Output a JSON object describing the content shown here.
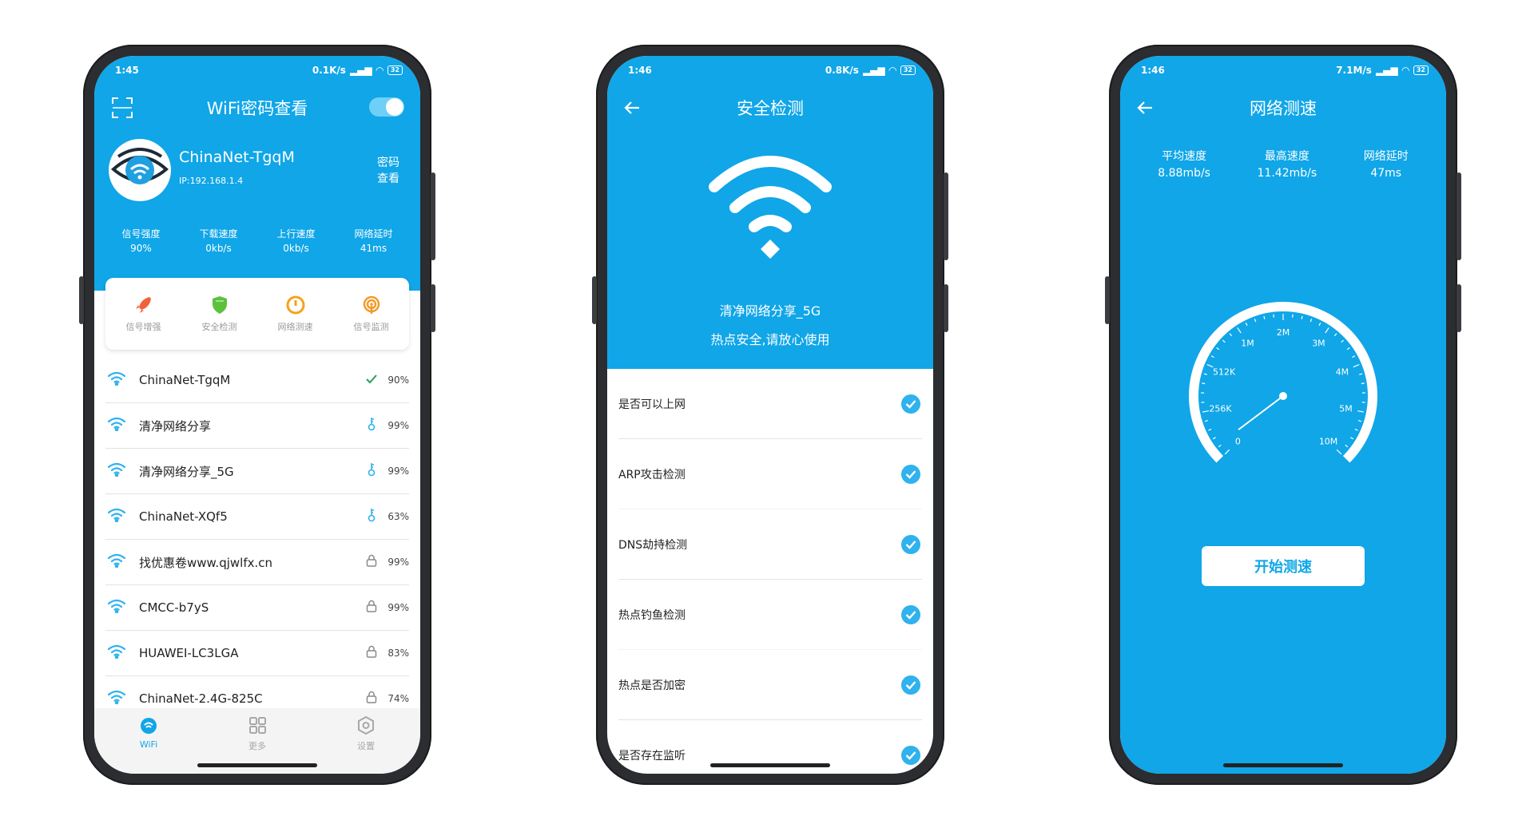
{
  "phone1": {
    "status": {
      "time": "1:45",
      "speed": "0.1K/s",
      "battery": "32"
    },
    "title": "WiFi密码查看",
    "connected": {
      "name": "ChinaNet-TgqM",
      "ip": "IP:192.168.1.4",
      "password_view": "密码查看"
    },
    "stats": [
      {
        "label": "信号强度",
        "value": "90%"
      },
      {
        "label": "下载速度",
        "value": "0kb/s"
      },
      {
        "label": "上行速度",
        "value": "0kb/s"
      },
      {
        "label": "网络延时",
        "value": "41ms"
      }
    ],
    "tools": [
      {
        "label": "信号增强",
        "icon": "rocket-icon",
        "color": "#f0623a"
      },
      {
        "label": "安全检测",
        "icon": "shield-icon",
        "color": "#5cc23c"
      },
      {
        "label": "网络测速",
        "icon": "speedometer-icon",
        "color": "#f3a31b"
      },
      {
        "label": "信号监测",
        "icon": "signal-monitor-icon",
        "color": "#f39a2a"
      }
    ],
    "wifi_list": [
      {
        "name": "ChinaNet-TgqM",
        "status": "check",
        "percent": "90%"
      },
      {
        "name": "清净网络分享",
        "status": "key",
        "percent": "99%"
      },
      {
        "name": "清净网络分享_5G",
        "status": "key",
        "percent": "99%"
      },
      {
        "name": "ChinaNet-XQf5",
        "status": "key",
        "percent": "63%"
      },
      {
        "name": "找优惠卷www.qjwlfx.cn",
        "status": "lock",
        "percent": "99%"
      },
      {
        "name": "CMCC-b7yS",
        "status": "lock",
        "percent": "99%"
      },
      {
        "name": "HUAWEI-LC3LGA",
        "status": "lock",
        "percent": "83%"
      },
      {
        "name": "ChinaNet-2.4G-825C",
        "status": "lock",
        "percent": "74%"
      }
    ],
    "tabs": [
      {
        "label": "WiFi",
        "active": true
      },
      {
        "label": "更多",
        "active": false
      },
      {
        "label": "设置",
        "active": false
      }
    ]
  },
  "phone2": {
    "status": {
      "time": "1:46",
      "speed": "0.8K/s",
      "battery": "32"
    },
    "title": "安全检测",
    "network": "清净网络分享_5G",
    "safe_text": "热点安全,请放心使用",
    "checks": [
      "是否可以上网",
      "ARP攻击检测",
      "DNS劫持检测",
      "热点钓鱼检测",
      "热点是否加密",
      "是否存在监听"
    ]
  },
  "phone3": {
    "status": {
      "time": "1:46",
      "speed": "7.1M/s",
      "battery": "32"
    },
    "title": "网络测速",
    "stats": [
      {
        "label": "平均速度",
        "value": "8.88mb/s"
      },
      {
        "label": "最高速度",
        "value": "11.42mb/s"
      },
      {
        "label": "网络延时",
        "value": "47ms"
      }
    ],
    "gauge_ticks": [
      "0",
      "256K",
      "512K",
      "1M",
      "2M",
      "3M",
      "4M",
      "5M",
      "10M"
    ],
    "start_button": "开始测速"
  },
  "colors": {
    "primary": "#10a6e8",
    "check": "#2fb2ee"
  }
}
